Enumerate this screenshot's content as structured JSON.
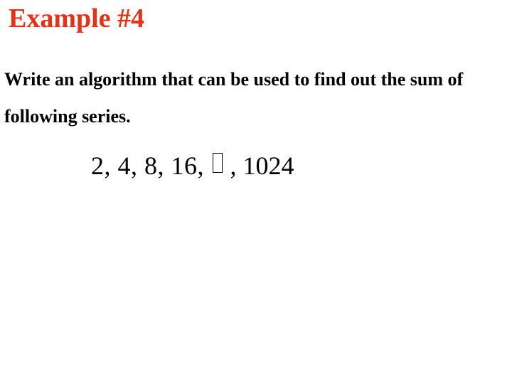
{
  "title": "Example #4",
  "body": "Write an algorithm that can be used to find out the sum of following series.",
  "series": {
    "prefix": "2, 4, 8, 16, ",
    "suffix": " , 1024"
  }
}
